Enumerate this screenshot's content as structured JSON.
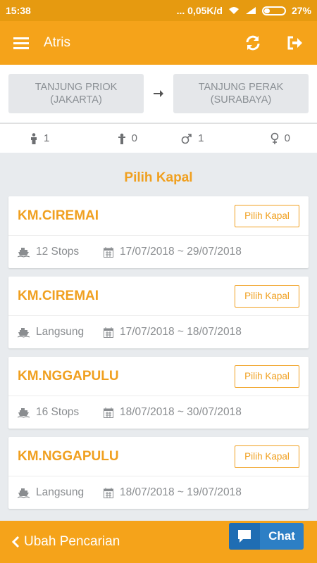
{
  "status_bar": {
    "time": "15:38",
    "network": "... 0,05K/d",
    "battery": "27%"
  },
  "app_bar": {
    "title": "Atris",
    "menu_icon": "menu-icon",
    "refresh_icon": "refresh-icon",
    "logout_icon": "logout-icon"
  },
  "route": {
    "origin_line1": "TANJUNG PRIOK",
    "origin_line2": "(JAKARTA)",
    "destination_line1": "TANJUNG PERAK",
    "destination_line2": "(SURABAYA)"
  },
  "passengers": {
    "adult": "1",
    "infant": "0",
    "male": "1",
    "female": "0"
  },
  "section_title": "Pilih Kapal",
  "ships": [
    {
      "name": "KM.CIREMAI",
      "button": "Pilih Kapal",
      "stops": "12 Stops",
      "dates": "17/07/2018 ~ 29/07/2018"
    },
    {
      "name": "KM.CIREMAI",
      "button": "Pilih Kapal",
      "stops": "Langsung",
      "dates": "17/07/2018 ~ 18/07/2018"
    },
    {
      "name": "KM.NGGAPULU",
      "button": "Pilih Kapal",
      "stops": "16 Stops",
      "dates": "18/07/2018 ~ 30/07/2018"
    },
    {
      "name": "KM.NGGAPULU",
      "button": "Pilih Kapal",
      "stops": "Langsung",
      "dates": "18/07/2018 ~ 19/07/2018"
    }
  ],
  "bottom_bar": {
    "back_label": "Ubah Pencarian",
    "chat_label": "Chat"
  },
  "colors": {
    "primary": "#f5a31a",
    "accent": "#f0a020",
    "chat": "#2d7fc5"
  }
}
